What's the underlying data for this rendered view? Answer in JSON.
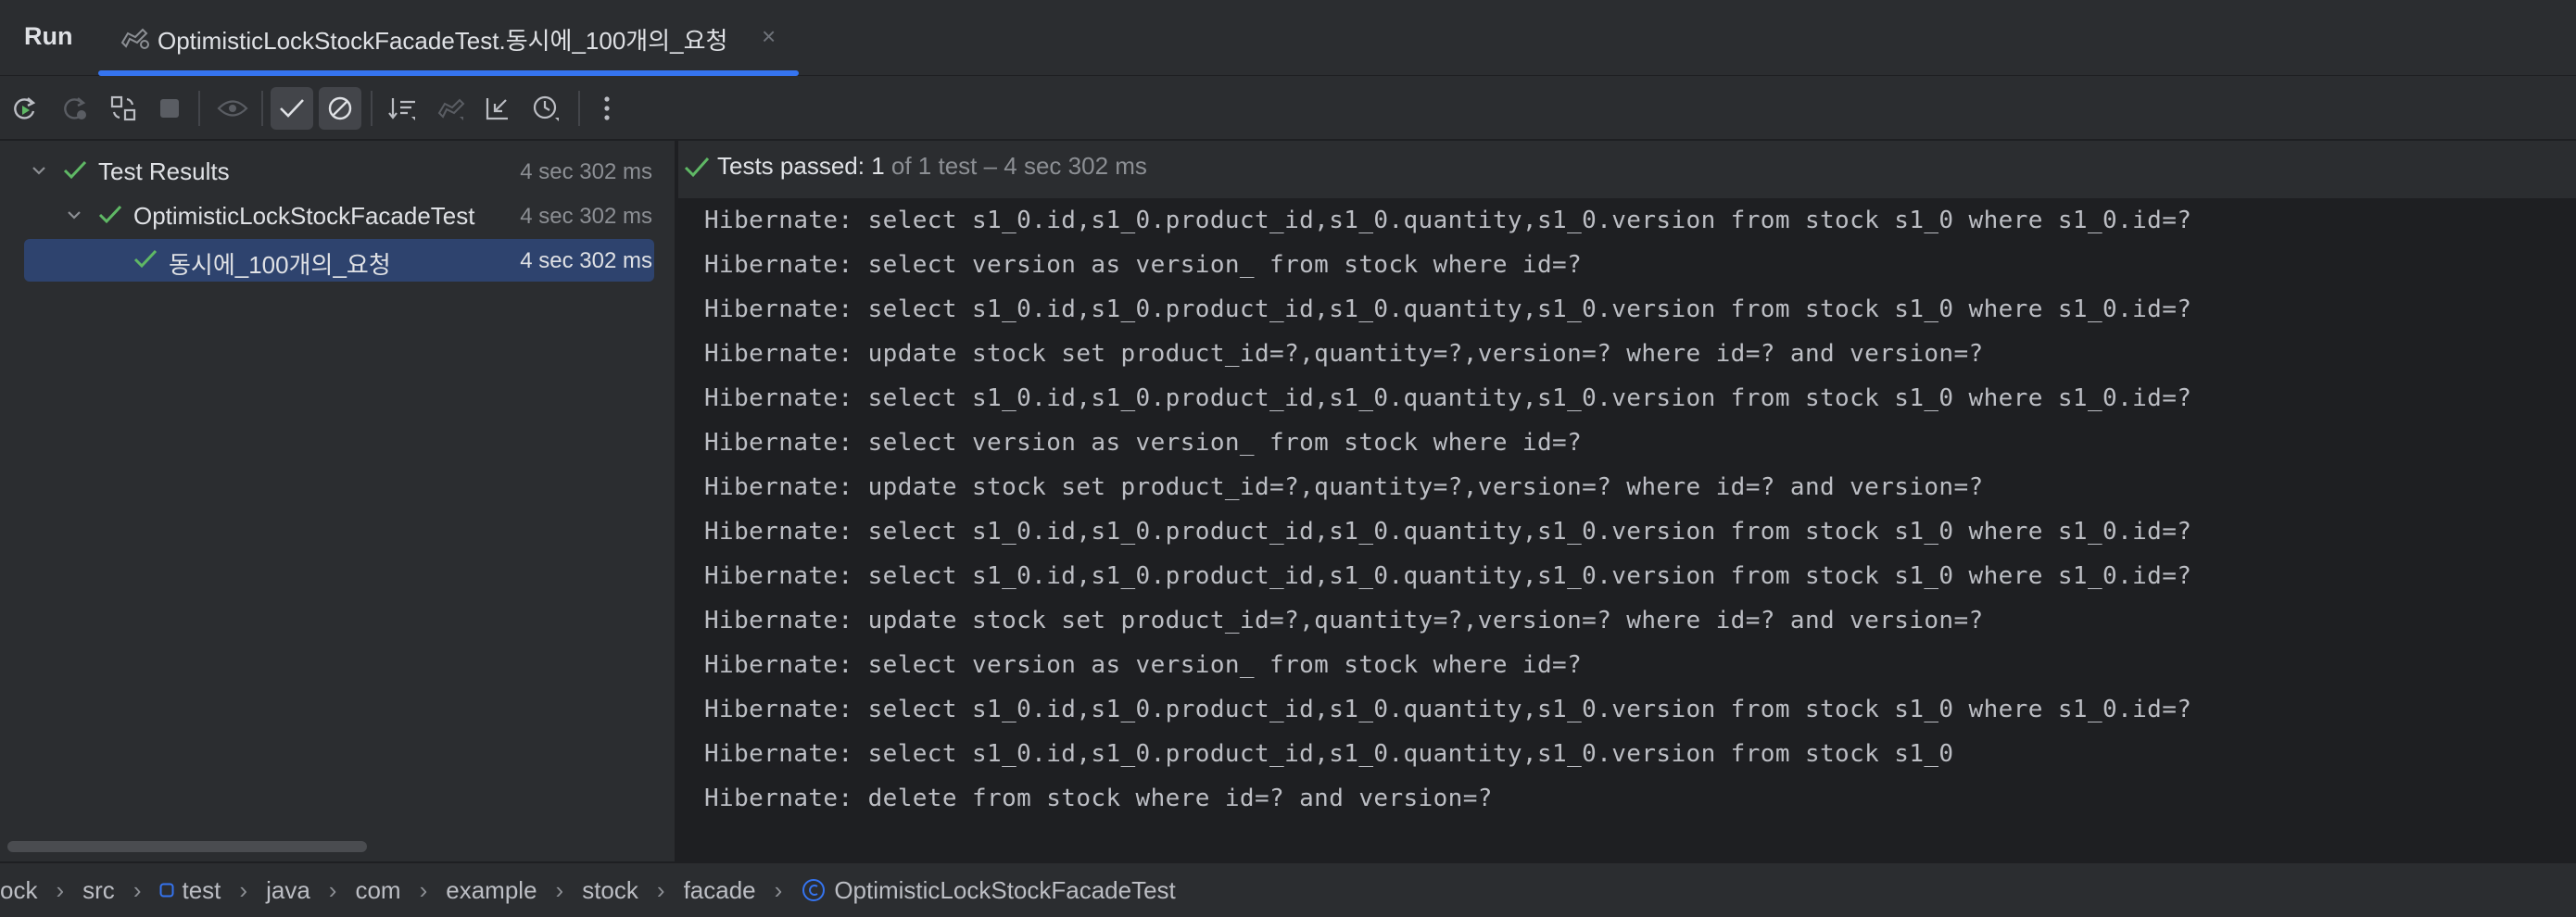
{
  "tool_window": {
    "title": "Run"
  },
  "tab": {
    "title": "OptimisticLockStockFacadeTest.동시에_100개의_요청",
    "close": "×"
  },
  "toolbar": {
    "buttons": [
      "rerun-icon",
      "rerun-failed-icon",
      "toggle-auto-test-icon",
      "stop-icon",
      "show-ignored-icon",
      "show-passed-icon",
      "show-ignored-toggle-icon",
      "sort-alphabetically-icon",
      "import-tests-icon",
      "collapse-all-icon",
      "history-icon",
      "more-options-icon"
    ]
  },
  "tree": {
    "items": [
      {
        "label": "Test Results",
        "time": "4 sec 302 ms"
      },
      {
        "label": "OptimisticLockStockFacadeTest",
        "time": "4 sec 302 ms"
      },
      {
        "label": "동시에_100개의_요청",
        "time": "4 sec 302 ms"
      }
    ]
  },
  "status": {
    "bold": "Tests passed: 1",
    "dim": " of 1 test – 4 sec 302 ms"
  },
  "console": {
    "lines": [
      "Hibernate: select s1_0.id,s1_0.product_id,s1_0.quantity,s1_0.version from stock s1_0 where s1_0.id=?",
      "Hibernate: select version as version_ from stock where id=?",
      "Hibernate: select s1_0.id,s1_0.product_id,s1_0.quantity,s1_0.version from stock s1_0 where s1_0.id=?",
      "Hibernate: update stock set product_id=?,quantity=?,version=? where id=? and version=?",
      "Hibernate: select s1_0.id,s1_0.product_id,s1_0.quantity,s1_0.version from stock s1_0 where s1_0.id=?",
      "Hibernate: select version as version_ from stock where id=?",
      "Hibernate: update stock set product_id=?,quantity=?,version=? where id=? and version=?",
      "Hibernate: select s1_0.id,s1_0.product_id,s1_0.quantity,s1_0.version from stock s1_0 where s1_0.id=?",
      "Hibernate: select s1_0.id,s1_0.product_id,s1_0.quantity,s1_0.version from stock s1_0 where s1_0.id=?",
      "Hibernate: update stock set product_id=?,quantity=?,version=? where id=? and version=?",
      "Hibernate: select version as version_ from stock where id=?",
      "Hibernate: select s1_0.id,s1_0.product_id,s1_0.quantity,s1_0.version from stock s1_0 where s1_0.id=?",
      "Hibernate: select s1_0.id,s1_0.product_id,s1_0.quantity,s1_0.version from stock s1_0",
      "Hibernate: delete from stock where id=? and version=?"
    ]
  },
  "breadcrumb": {
    "items": [
      "ock",
      "src",
      "test",
      "java",
      "com",
      "example",
      "stock",
      "facade",
      "OptimisticLockStockFacadeTest"
    ],
    "separator": "›"
  },
  "colors": {
    "accent": "#3574f0",
    "success": "#5fb865",
    "selection": "#2e436e"
  }
}
